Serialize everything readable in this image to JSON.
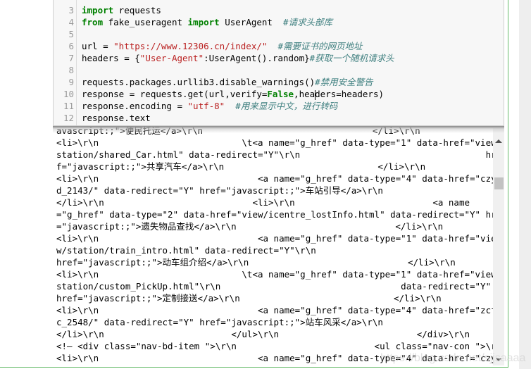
{
  "cell": {
    "code_lines": [
      {
        "num": "3",
        "parts": [
          {
            "t": "import",
            "c": "kw"
          },
          {
            "t": " requests",
            "c": ""
          }
        ]
      },
      {
        "num": "4",
        "parts": [
          {
            "t": "from",
            "c": "kw"
          },
          {
            "t": " fake_useragent ",
            "c": ""
          },
          {
            "t": "import",
            "c": "kw"
          },
          {
            "t": " UserAgent  ",
            "c": ""
          },
          {
            "t": "#请求头部库",
            "c": "cmt"
          }
        ]
      },
      {
        "num": "5",
        "parts": []
      },
      {
        "num": "6",
        "parts": [
          {
            "t": "url = ",
            "c": ""
          },
          {
            "t": "\"https://www.12306.cn/index/\"",
            "c": "str"
          },
          {
            "t": "  ",
            "c": ""
          },
          {
            "t": "#需要证书的网页地址",
            "c": "cmt"
          }
        ]
      },
      {
        "num": "7",
        "parts": [
          {
            "t": "headers = {",
            "c": ""
          },
          {
            "t": "\"User-Agent\"",
            "c": "str"
          },
          {
            "t": ":UserAgent().random}",
            "c": ""
          },
          {
            "t": "#获取一个随机请求头",
            "c": "cmt"
          }
        ]
      },
      {
        "num": "8",
        "parts": []
      },
      {
        "num": "9",
        "parts": [
          {
            "t": "requests.packages.urllib3.disable_warnings()",
            "c": ""
          },
          {
            "t": "#禁用安全警告",
            "c": "cmt"
          }
        ]
      },
      {
        "num": "10",
        "parts": [
          {
            "t": "response = requests.get(url,verify=",
            "c": ""
          },
          {
            "t": "False",
            "c": "kw"
          },
          {
            "t": ",hea",
            "c": ""
          },
          {
            "t": "|",
            "c": "cursor"
          },
          {
            "t": "ders=headers)",
            "c": ""
          }
        ]
      },
      {
        "num": "11",
        "parts": [
          {
            "t": "response.encoding = ",
            "c": ""
          },
          {
            "t": "\"utf-8\"",
            "c": "str"
          },
          {
            "t": "  ",
            "c": ""
          },
          {
            "t": "#用来显示中文，进行转码",
            "c": "cmt"
          }
        ]
      },
      {
        "num": "12",
        "parts": [
          {
            "t": "response.text",
            "c": ""
          }
        ]
      }
    ]
  },
  "output": {
    "lines": [
      "avascript:;\">便民托运</a>\\r\\n                                </li>\\r\\n",
      "<li>\\r\\n                           \\t<a name=\"g_href\" data-type=\"1\" data-href=\"view/",
      "station/shared_Car.html\" data-redirect=\"Y\"\\r\\n                                   hre",
      "f=\"javascript:;\">共享汽车</a>\\r\\n                             </li>\\r\\n",
      "<li>\\r\\n                              <a name=\"g_href\" data-type=\"4\" data-href=\"czy",
      "d_2143/\" data-redirect=\"Y\" href=\"javascript:;\">车站引导</a>\\r\\n",
      "</li>\\r\\n                            <li>\\r\\n                          <a name",
      "=\"g_href\" data-type=\"2\" data-href=\"view/icentre_lostInfo.html\" data-redirect=\"Y\" href",
      "=\"javascript:;\">遗失物品查找</a>\\r\\n                              </li>\\r\\n",
      "<li>\\r\\n                              <a name=\"g_href\" data-type=\"1\" data-href=\"vie",
      "w/station/train_intro.html\" data-redirect=\"Y\"\\r\\n",
      "href=\"javascript:;\">动车组介绍</a>\\r\\n                              </li>\\r\\n",
      "<li>\\r\\n                           \\t<a name=\"g_href\" data-type=\"1\" data-href=\"view/",
      "station/custom_PickUp.html\"\\r\\n                                  data-redirect=\"Y\"",
      "href=\"javascript:;\">定制接送</a>\\r\\n                             </li>\\r\\n",
      "<li>\\r\\n                              <a name=\"g_href\" data-type=\"4\" data-href=\"zcf",
      "c_2548/\" data-redirect=\"Y\" href=\"javascript:;\">站车风采</a>\\r\\n",
      "</li>\\r\\n                        </ul>\\r\\n                          </div>\\r\\n",
      "<!— <div class=\"nav-bd-item \">\\r\\n                          <ul class=\"nav-con \">\\r\\n",
      "<li>\\r\\n                              <a name=\"g_href\" data-type=\"4\" data-href=\"czy"
    ]
  },
  "watermark": "https://blog.csdn.net/sjjsaaaa",
  "colors": {
    "keyword": "#008000",
    "string": "#ba2121",
    "comment": "#408080",
    "cell_selected_border": "#66bb6a"
  }
}
